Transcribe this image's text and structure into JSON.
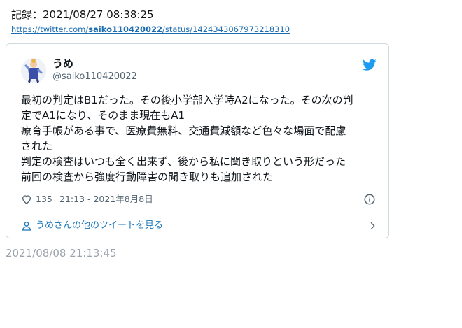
{
  "record": {
    "text": "記録：2021/08/27 08:38:25"
  },
  "source_url": {
    "prefix": "https://twitter.com/",
    "user": "saiko110420022",
    "suffix": "/status/1424343067973218310"
  },
  "tweet": {
    "display_name": "うめ",
    "handle": "@saiko110420022",
    "lines": [
      "最初の判定はB1だった。その後小学部入学時A2になった。その次の判",
      "定でA1になり、そのまま現在もA1",
      "療育手帳がある事で、医療費無料、交通費減額など色々な場面で配慮",
      "された",
      "判定の検査はいつも全く出来ず、後から私に聞き取りという形だった",
      "前回の検査から強度行動障害の聞き取りも追加された"
    ],
    "likes": "135",
    "time": "21:13 - 2021年8月8日",
    "more_link": "うめさんの他のツイートを見る"
  },
  "icons": {
    "bird": "twitter-bird-icon",
    "heart": "heart-icon",
    "info": "info-icon",
    "person": "person-icon",
    "chevron": "chevron-right-icon"
  },
  "colors": {
    "link": "#1b76b8",
    "twitter_blue": "#1d9bf0",
    "muted": "#536471",
    "timestamp": "#9aa3ab"
  },
  "archived_timestamp": "2021/08/08 21:13:45"
}
